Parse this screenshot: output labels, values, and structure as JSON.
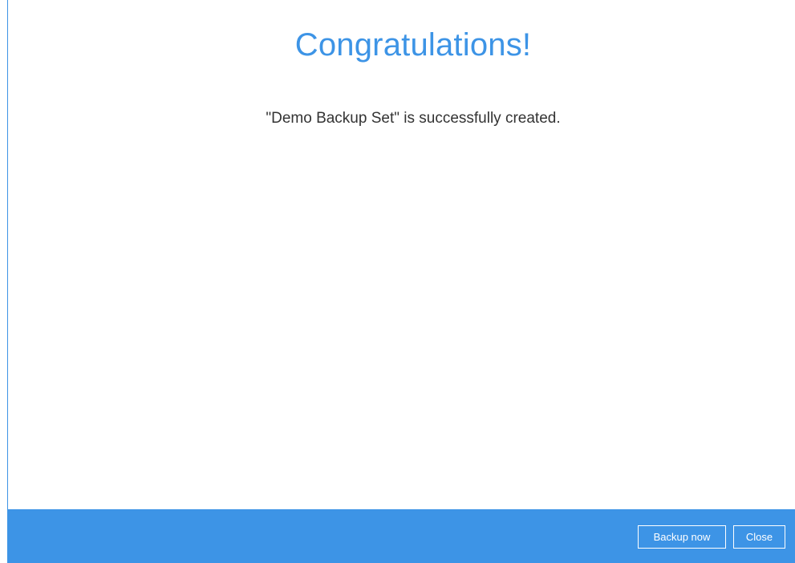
{
  "dialog": {
    "title": "Congratulations!",
    "message": "\"Demo Backup Set\" is successfully created."
  },
  "footer": {
    "backup_now_label": "Backup now",
    "close_label": "Close"
  },
  "colors": {
    "accent": "#3d94e6",
    "text": "#333333",
    "background": "#ffffff"
  }
}
